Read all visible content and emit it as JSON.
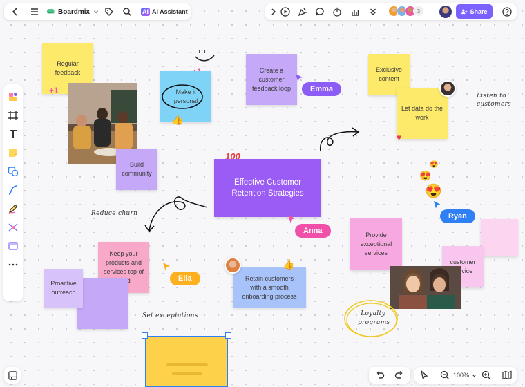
{
  "topbar": {
    "brand": "Boardmix",
    "ai_label": "AI Assistant",
    "collaborator_overflow": "3",
    "share_label": "Share"
  },
  "zoom": {
    "level": "100%"
  },
  "notes": {
    "regular_feedback": "Regular feedback",
    "make_it_personal": "Make it personal",
    "create_feedback_loop": "Create a customer feedback loop",
    "exclusive_content": "Exclusive content",
    "let_data_do_work": "Let data do the work",
    "build_community": "Build community",
    "center_title": "Effective Customer Retention Strategies",
    "keep_products": "Keep your products and services top of mind",
    "proactive_outreach": "Proactive outreach",
    "onboarding": "Retain customers with a smooth onboarding process",
    "exceptional_services": "Provide exceptional services",
    "customer_service": "customer service"
  },
  "badges": {
    "plus_one_a": "+1",
    "plus_one_b": "+1",
    "hundred": "100"
  },
  "cursors": {
    "emma": "Emma",
    "anna": "Anna",
    "ryan": "Ryan",
    "elia": "Elia"
  },
  "annotations": {
    "listen": "Listen to customers",
    "reduce_churn": "Reduce churn",
    "set_exceptations": "Set exceptations",
    "loyalty_programs": "Loyalty programs"
  },
  "colors": {
    "accent": "#7b61ff",
    "emma": "#8c5cf6",
    "anna": "#f050a8",
    "ryan": "#2f7ff5",
    "elia": "#ffb020",
    "sticky_yellow": "#fde96a",
    "sticky_purple": "#c6a8f8",
    "sticky_blue": "#7fd3f7",
    "sticky_pink": "#f8b4e4"
  }
}
